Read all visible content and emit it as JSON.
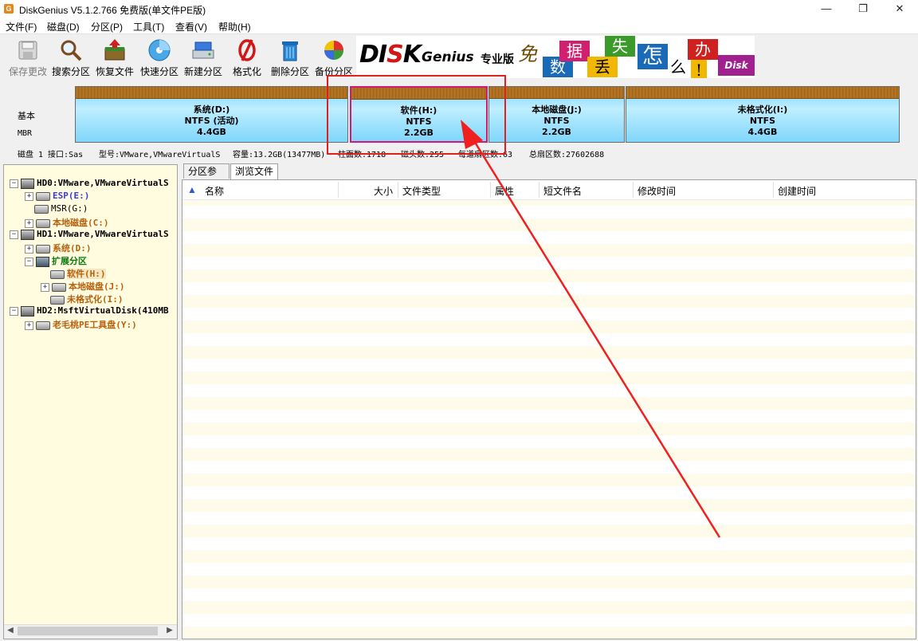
{
  "window": {
    "title": "DiskGenius V5.1.2.766 免费版(单文件PE版)",
    "app_icon_letter": "G"
  },
  "menu": {
    "file": "文件(F)",
    "disk": "磁盘(D)",
    "partition": "分区(P)",
    "tools": "工具(T)",
    "view": "查看(V)",
    "help": "帮助(H)"
  },
  "toolbar": {
    "save": "保存更改",
    "search": "搜索分区",
    "recover": "恢复文件",
    "quick": "快速分区",
    "new": "新建分区",
    "format": "格式化",
    "delete": "删除分区",
    "backup": "备份分区"
  },
  "banner": {
    "logo_a": "DI",
    "logo_b": "K",
    "logo_genius": "Genius",
    "logo_pro": "专业版",
    "tiles": [
      "免",
      "数",
      "据",
      "丢",
      "失",
      "怎",
      "么",
      "办",
      "!"
    ],
    "tail": "Disk"
  },
  "diskmap": {
    "basic": "基本",
    "mbr": "MBR",
    "partitions": [
      {
        "name": "系统(D:)",
        "fs": "NTFS (活动)",
        "size": "4.4GB"
      },
      {
        "name": "软件(H:)",
        "fs": "NTFS",
        "size": "2.2GB"
      },
      {
        "name": "本地磁盘(J:)",
        "fs": "NTFS",
        "size": "2.2GB"
      },
      {
        "name": "未格式化(I:)",
        "fs": "NTFS",
        "size": "4.4GB"
      }
    ]
  },
  "diskinfo": {
    "disk": "磁盘 1 接口:Sas",
    "model": "型号:VMware,VMwareVirtualS",
    "capacity": "容量:13.2GB(13477MB)",
    "cylinders": "柱面数:1718",
    "heads": "磁头数:255",
    "sectors_per_track": "每道扇区数:63",
    "total_sectors": "总扇区数:27602688"
  },
  "tree": {
    "items": [
      {
        "label": "HD0:VMware,VMwareVirtualS"
      },
      {
        "label": "ESP(E:)"
      },
      {
        "label": "MSR(G:)"
      },
      {
        "label": "本地磁盘(C:)"
      },
      {
        "label": "HD1:VMware,VMwareVirtualS"
      },
      {
        "label": "系统(D:)"
      },
      {
        "label": "扩展分区"
      },
      {
        "label": "软件(H:)"
      },
      {
        "label": "本地磁盘(J:)"
      },
      {
        "label": "未格式化(I:)"
      },
      {
        "label": "HD2:MsftVirtualDisk(410MB"
      },
      {
        "label": "老毛桃PE工具盘(Y:)"
      }
    ]
  },
  "tabs": {
    "params": "分区参数",
    "browse": "浏览文件"
  },
  "columns": {
    "name": "名称",
    "size": "大小",
    "type": "文件类型",
    "attr": "属性",
    "short": "短文件名",
    "modified": "修改时间",
    "created": "创建时间"
  },
  "colors": {
    "annotation": "#e02020",
    "selected_partition": "#d4187a"
  }
}
